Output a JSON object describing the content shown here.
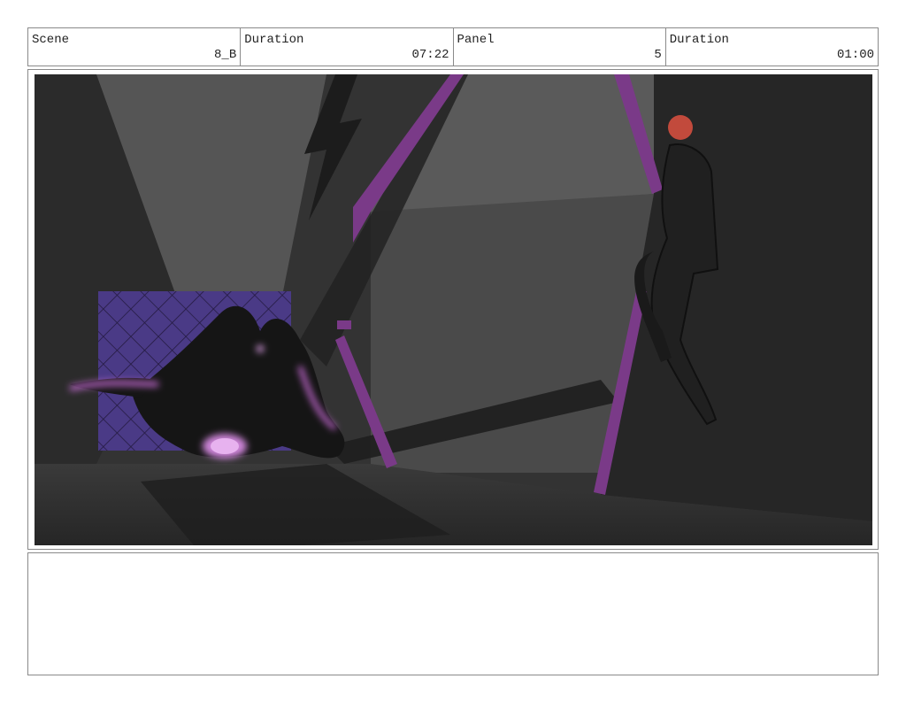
{
  "header": {
    "scene_label": "Scene",
    "scene_value": "8_B",
    "duration1_label": "Duration",
    "duration1_value": "07:22",
    "panel_label": "Panel",
    "panel_value": "5",
    "duration2_label": "Duration",
    "duration2_value": "01:00"
  },
  "notes": {
    "text": ""
  },
  "colors": {
    "glow": "#c86bd6",
    "pillar": "#7a3a88",
    "grid_panel": "#4a3a86",
    "head": "#c24a3c"
  }
}
